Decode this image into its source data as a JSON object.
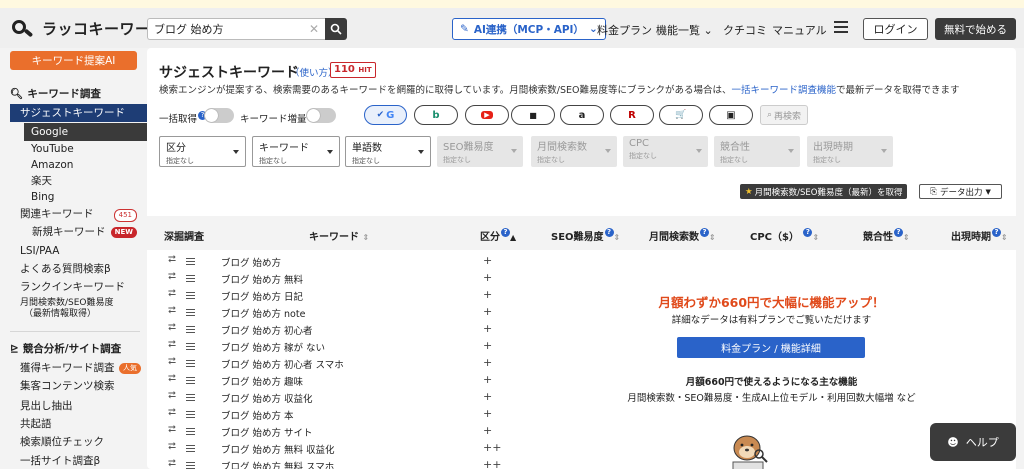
{
  "app": {
    "logo_text": "ラッコキーワード"
  },
  "search": {
    "value": "ブログ 始め方",
    "clear": "✕"
  },
  "header": {
    "ai_button": "AI連携（MCP・API）",
    "nav": [
      "料金プラン",
      "機能一覧",
      "クチコミ",
      "マニュアル"
    ],
    "login": "ログイン",
    "start": "無料で始める"
  },
  "sidebar": {
    "ai_button": "キーワード提案AI",
    "section1": "キーワード調査",
    "suggest": "サジェストキーワード",
    "engines": [
      "Google",
      "YouTube",
      "Amazon",
      "楽天",
      "Bing"
    ],
    "related": "関連キーワード",
    "related_count": "451",
    "new_kw": "新規キーワード",
    "new_badge": "NEW",
    "lsi": "LSI/PAA",
    "faq": "よくある質問検索β",
    "rankin": "ランクインキーワード",
    "volume_line1": "月間検索数/SEO難易度",
    "volume_line2": "（最新情報取得）",
    "section2": "競合分析/サイト調査",
    "acquired": "獲得キーワード調査",
    "popular_badge": "人気",
    "content": "集客コンテンツ検索",
    "headings": "見出し抽出",
    "cooccur": "共起語",
    "rank_check": "検索順位チェック",
    "bulk": "一括サイト調査β"
  },
  "main": {
    "title": "サジェストキーワード",
    "howto": "（使い方）",
    "hit_count": "110",
    "hit_unit": "HIT",
    "desc_before": "検索エンジンが提案する、検索需要のあるキーワードを網羅的に取得しています。月間検索数/SEO難易度等にブランクがある場合は、",
    "desc_link": "一括キーワード調査機能",
    "desc_after": "で最新データを取得できます",
    "bulk_label": "一括取得",
    "expand_label": "キーワード増量",
    "rescan": "再検索",
    "fetch_button": "月間検索数/SEO難易度（最新）を取得",
    "export_button": "データ出力",
    "engines": [
      {
        "icon": "google-icon",
        "label": "G"
      },
      {
        "icon": "bing-icon",
        "label": "b"
      },
      {
        "icon": "youtube-icon",
        "label": "▶"
      },
      {
        "icon": "video-icon",
        "label": "■"
      },
      {
        "icon": "amazon-icon",
        "label": "a"
      },
      {
        "icon": "rakuten-icon",
        "label": "R"
      },
      {
        "icon": "cart-icon",
        "label": "🛒"
      },
      {
        "icon": "image-icon",
        "label": "▣"
      }
    ],
    "filters": [
      {
        "label": "区分",
        "value": "指定なし",
        "disabled": false
      },
      {
        "label": "キーワード",
        "value": "指定なし",
        "disabled": false
      },
      {
        "label": "単語数",
        "value": "指定なし",
        "disabled": false
      },
      {
        "label": "SEO難易度",
        "value": "指定なし",
        "disabled": true
      },
      {
        "label": "月間検索数",
        "value": "指定なし",
        "disabled": true
      },
      {
        "label": "CPC",
        "value": "指定なし",
        "disabled": true
      },
      {
        "label": "競合性",
        "value": "指定なし",
        "disabled": true
      },
      {
        "label": "出現時期",
        "value": "指定なし",
        "disabled": true
      }
    ]
  },
  "table": {
    "headers": [
      "深掘調査",
      "キーワード",
      "区分",
      "SEO難易度",
      "月間検索数",
      "CPC（$）",
      "競合性",
      "出現時期"
    ],
    "rows": [
      {
        "keyword": "ブログ 始め方",
        "cat": "+"
      },
      {
        "keyword": "ブログ 始め方 無料",
        "cat": "+"
      },
      {
        "keyword": "ブログ 始め方 日記",
        "cat": "+"
      },
      {
        "keyword": "ブログ 始め方 note",
        "cat": "+"
      },
      {
        "keyword": "ブログ 始め方 初心者",
        "cat": "+"
      },
      {
        "keyword": "ブログ 始め方 稼が ない",
        "cat": "+"
      },
      {
        "keyword": "ブログ 始め方 初心者 スマホ",
        "cat": "+"
      },
      {
        "keyword": "ブログ 始め方 趣味",
        "cat": "+"
      },
      {
        "keyword": "ブログ 始め方 収益化",
        "cat": "+"
      },
      {
        "keyword": "ブログ 始め方 本",
        "cat": "+"
      },
      {
        "keyword": "ブログ 始め方 サイト",
        "cat": "+"
      },
      {
        "keyword": "ブログ 始め方 無料 収益化",
        "cat": "++"
      },
      {
        "keyword": "ブログ 始め方 無料 スマホ",
        "cat": "++"
      }
    ]
  },
  "promo": {
    "title": "月額わずか660円で大幅に機能アップ！",
    "sub": "詳細なデータは有料プランでご覧いただけます",
    "button": "料金プラン / 機能詳細",
    "feature_title": "月額660円で使えるようになる主な機能",
    "features": "月間検索数・SEO難易度・生成AI上位モデル・利用回数大幅増 など"
  },
  "help": {
    "label": "ヘルプ"
  },
  "colors": {
    "accent_blue": "#2a63c9",
    "orange": "#ea6f2c",
    "navy": "#1e3d75",
    "red": "#c8262b"
  }
}
